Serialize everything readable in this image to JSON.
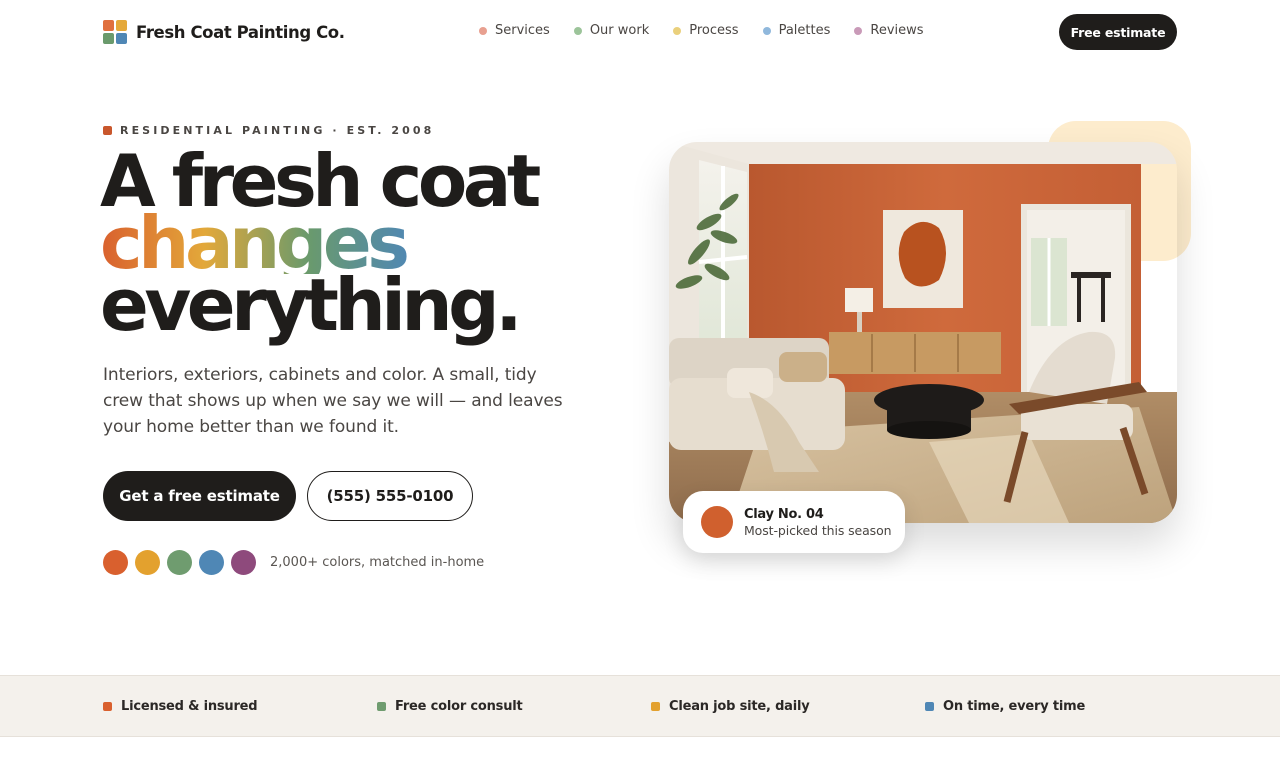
{
  "brand": {
    "name": "Fresh Coat Painting Co.",
    "logo_colors": [
      "#e0703e",
      "#e5a93a",
      "#6a9a6c",
      "#4f87b5"
    ]
  },
  "nav": {
    "items": [
      {
        "label": "Services",
        "dot_color": "#e8a090"
      },
      {
        "label": "Our work",
        "dot_color": "#9cc49a"
      },
      {
        "label": "Process",
        "dot_color": "#ead07c"
      },
      {
        "label": "Palettes",
        "dot_color": "#90b8dc"
      },
      {
        "label": "Reviews",
        "dot_color": "#c99ab8"
      }
    ],
    "cta_label": "Free estimate"
  },
  "hero": {
    "eyebrow": "RESIDENTIAL PAINTING · EST. 2008",
    "eyebrow_color": "#c9572c",
    "headline_line1": "A fresh coat",
    "headline_line2": "changes",
    "headline_line3": "everything.",
    "headline_gradient": [
      "#d9602e",
      "#e3a83a",
      "#6a9a6c",
      "#4f87b5"
    ],
    "lead": "Interiors, exteriors, cabinets and color. A small, tidy crew that shows up when we say we will — and leaves your home better than we found it.",
    "primary_button": "Get a free estimate",
    "phone_button": "(555) 555-0100",
    "swatches": [
      "#d9602e",
      "#e3a12e",
      "#6f9c6f",
      "#4f87b5",
      "#8e4a7c"
    ],
    "swatch_caption": "2,000+ colors, matched in-home"
  },
  "color_card": {
    "name": "Clay No. 04",
    "subtitle": "Most-picked this season",
    "dot_color": "#d0602e"
  },
  "trust_bar": [
    {
      "label": "Licensed & insured",
      "color": "#d9602e"
    },
    {
      "label": "Free color consult",
      "color": "#6f9c6f"
    },
    {
      "label": "Clean job site, daily",
      "color": "#e3a12e"
    },
    {
      "label": "On time, every time",
      "color": "#4f87b5"
    }
  ]
}
